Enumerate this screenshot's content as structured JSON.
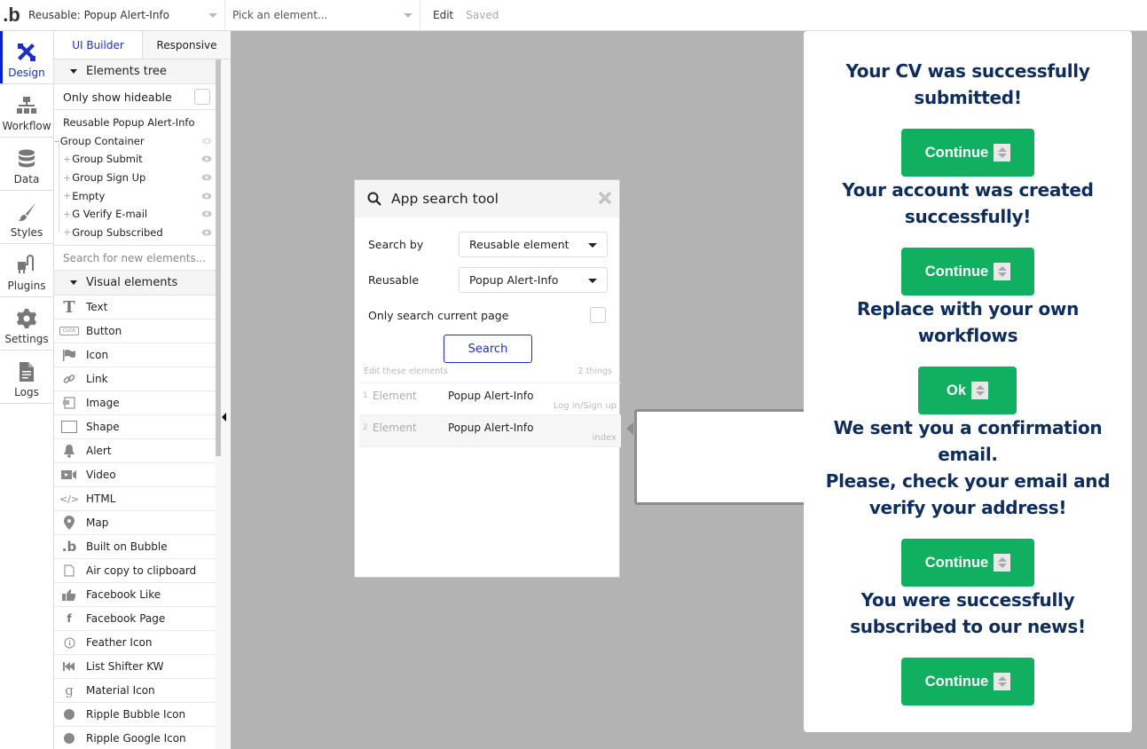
{
  "topbar": {
    "logo": ".b",
    "page_selector": "Reusable: Popup Alert-Info",
    "element_picker_placeholder": "Pick an element...",
    "edit_label": "Edit",
    "status": "Saved"
  },
  "leftnav": {
    "items": [
      {
        "label": "Design",
        "icon": "design-icon",
        "active": true
      },
      {
        "label": "Workflow",
        "icon": "workflow-icon"
      },
      {
        "label": "Data",
        "icon": "database-icon"
      },
      {
        "label": "Styles",
        "icon": "brush-icon"
      },
      {
        "label": "Plugins",
        "icon": "plug-icon"
      },
      {
        "label": "Settings",
        "icon": "gear-icon"
      },
      {
        "label": "Logs",
        "icon": "document-icon"
      }
    ]
  },
  "panel": {
    "tabs": [
      {
        "label": "UI Builder",
        "active": true
      },
      {
        "label": "Responsive"
      }
    ],
    "elements_tree": {
      "title": "Elements tree",
      "only_hideable_label": "Only show hideable",
      "only_hideable_checked": false,
      "root": "Reusable Popup Alert-Info",
      "container": "Group Container",
      "children": [
        "Group Submit",
        "Group Sign Up",
        "Empty",
        "G Verify E-mail",
        "Group Subscribed"
      ]
    },
    "search_placeholder": "Search for new elements...",
    "visual_elements": {
      "title": "Visual elements",
      "items": [
        {
          "label": "Text",
          "icon": "text-icon"
        },
        {
          "label": "Button",
          "icon": "button-icon"
        },
        {
          "label": "Icon",
          "icon": "flag-icon"
        },
        {
          "label": "Link",
          "icon": "link-icon"
        },
        {
          "label": "Image",
          "icon": "image-icon"
        },
        {
          "label": "Shape",
          "icon": "shape-icon"
        },
        {
          "label": "Alert",
          "icon": "bell-icon"
        },
        {
          "label": "Video",
          "icon": "video-icon"
        },
        {
          "label": "HTML",
          "icon": "code-icon"
        },
        {
          "label": "Map",
          "icon": "map-pin-icon"
        },
        {
          "label": "Built on Bubble",
          "icon": "bubble-logo-icon"
        },
        {
          "label": "Air copy to clipboard",
          "icon": "clipboard-icon"
        },
        {
          "label": "Facebook Like",
          "icon": "thumbs-up-icon"
        },
        {
          "label": "Facebook Page",
          "icon": "facebook-icon"
        },
        {
          "label": "Feather Icon",
          "icon": "info-circle-icon"
        },
        {
          "label": "List Shifter KW",
          "icon": "rewind-icon"
        },
        {
          "label": "Material Icon",
          "icon": "material-g-icon"
        },
        {
          "label": "Ripple Bubble Icon",
          "icon": "circle-icon"
        },
        {
          "label": "Ripple Google Icon",
          "icon": "circle-icon"
        }
      ]
    }
  },
  "search_tool": {
    "title": "App search tool",
    "search_by_label": "Search by",
    "search_by_value": "Reusable element",
    "reusable_label": "Reusable",
    "reusable_value": "Popup Alert-Info",
    "only_current_page_label": "Only search current page",
    "only_current_page_checked": false,
    "search_button": "Search",
    "results_header": "Edit these elements",
    "results_count": "2 things",
    "results": [
      {
        "num": "1",
        "type": "Element",
        "name": "Popup Alert-Info",
        "page": "Log in/Sign up"
      },
      {
        "num": "2",
        "type": "Element",
        "name": "Popup Alert-Info",
        "page": "index"
      }
    ]
  },
  "popup": {
    "messages": [
      "Your CV was successfully submitted!",
      "Your account was created successfully!",
      "Replace with your own workflows",
      "We sent you a confirmation email. Please, check your email and verify your address!",
      "You were successfully subscribed to our news!"
    ],
    "message_lines": [
      [
        "Your CV was successfully",
        "submitted!"
      ],
      [
        "Your account was created",
        "successfully!"
      ],
      [
        "Replace with your own",
        "workflows"
      ],
      [
        "We sent you a confirmation",
        "email.",
        "Please, check your email and",
        "verify your address!"
      ],
      [
        "You were successfully",
        "subscribed to our news!"
      ]
    ],
    "buttons": [
      "Continue",
      "Continue",
      "Ok",
      "Continue",
      "Continue"
    ],
    "accent_color": "#10b060",
    "text_color": "#0e2d5c"
  }
}
